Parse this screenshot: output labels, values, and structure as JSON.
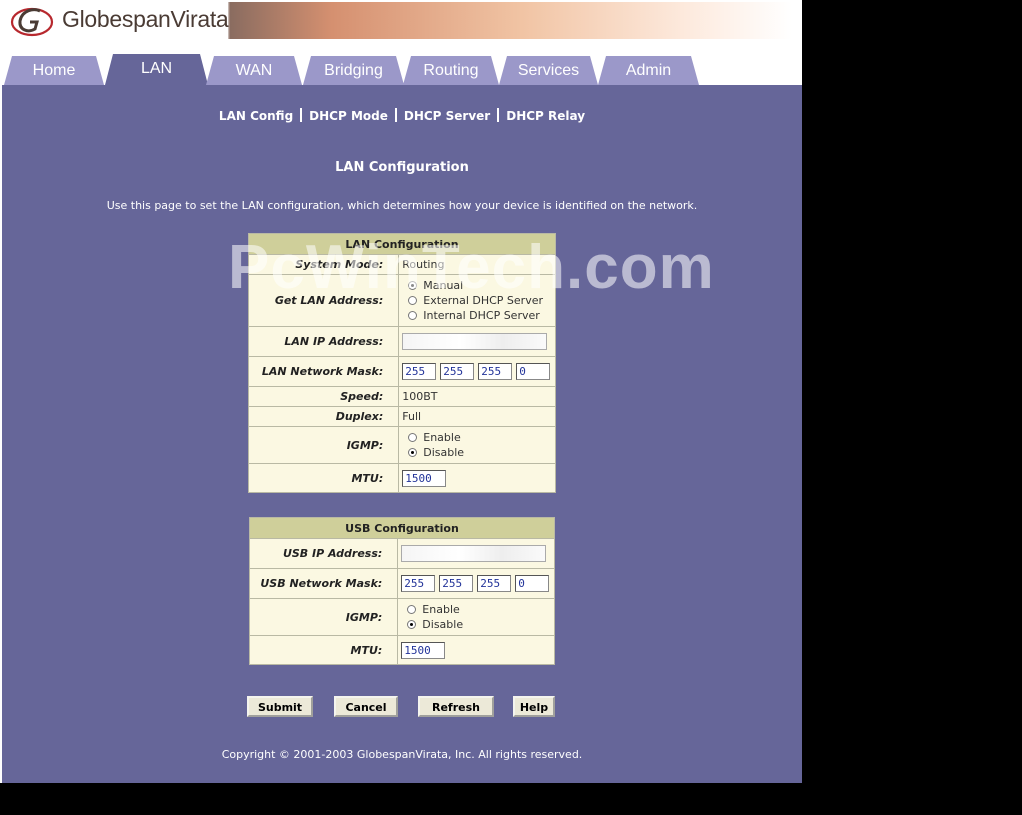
{
  "brand": {
    "name": "GlobespanVirata"
  },
  "tabs": [
    {
      "label": "Home",
      "active": false
    },
    {
      "label": "LAN",
      "active": true
    },
    {
      "label": "WAN",
      "active": false
    },
    {
      "label": "Bridging",
      "active": false
    },
    {
      "label": "Routing",
      "active": false
    },
    {
      "label": "Services",
      "active": false
    },
    {
      "label": "Admin",
      "active": false
    }
  ],
  "subnav": [
    "LAN Config",
    "DHCP Mode",
    "DHCP Server",
    "DHCP Relay"
  ],
  "page": {
    "title": "LAN Configuration",
    "description": "Use this page to set the LAN configuration, which determines how your device is identified on the network."
  },
  "lan": {
    "header": "LAN Configuration",
    "system_mode_label": "System Mode:",
    "system_mode_value": "Routing",
    "get_lan_address_label": "Get LAN Address:",
    "get_lan_address_options": [
      "Manual",
      "External DHCP Server",
      "Internal DHCP Server"
    ],
    "get_lan_address_selected": "Manual",
    "ip_label": "LAN IP Address:",
    "mask_label": "LAN Network Mask:",
    "mask": [
      "255",
      "255",
      "255",
      "0"
    ],
    "speed_label": "Speed:",
    "speed_value": "100BT",
    "duplex_label": "Duplex:",
    "duplex_value": "Full",
    "igmp_label": "IGMP:",
    "igmp_options": [
      "Enable",
      "Disable"
    ],
    "igmp_selected": "Disable",
    "mtu_label": "MTU:",
    "mtu_value": "1500"
  },
  "usb": {
    "header": "USB Configuration",
    "ip_label": "USB IP Address:",
    "mask_label": "USB Network Mask:",
    "mask": [
      "255",
      "255",
      "255",
      "0"
    ],
    "igmp_label": "IGMP:",
    "igmp_options": [
      "Enable",
      "Disable"
    ],
    "igmp_selected": "Disable",
    "mtu_label": "MTU:",
    "mtu_value": "1500"
  },
  "buttons": {
    "submit": "Submit",
    "cancel": "Cancel",
    "refresh": "Refresh",
    "help": "Help"
  },
  "footer": {
    "copyright": "Copyright © 2001-2003 GlobespanVirata, Inc. All rights reserved."
  },
  "watermark": "PcWinTech.com",
  "colors": {
    "content_bg": "#666699",
    "tab_inactive": "#9b98c9",
    "table_bg": "#fbf8e2",
    "table_header": "#cfcf9a"
  }
}
